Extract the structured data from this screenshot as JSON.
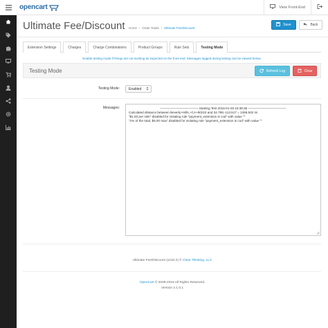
{
  "header": {
    "logo_text": "opencart",
    "view_frontend": "View Front-End"
  },
  "sidebar": {
    "items": [
      "dashboard-icon",
      "tag-icon",
      "puzzle-icon",
      "monitor-icon",
      "cart-icon",
      "user-icon",
      "user-plus-icon",
      "share-icon",
      "gear-icon",
      "chart-icon"
    ]
  },
  "page": {
    "title": "Ultimate Fee/Discount",
    "breadcrumb": [
      "Home",
      "Order Totals",
      "Ultimate Fee/Discount"
    ],
    "save_label": "Save",
    "back_label": "Back"
  },
  "tabs": [
    "Extension Settings",
    "Charges",
    "Charge Combinations",
    "Product Groups",
    "Rule Sets",
    "Testing Mode"
  ],
  "active_tab": "Testing Mode",
  "testing": {
    "help_text": "Enable testing mode if things are not working as expected on the front end. Messages logged during testing can be viewed below.",
    "section_title": "Testing Mode",
    "refresh_label": "Refresh Log",
    "clear_label": "Clear",
    "mode_label": "Testing Mode:",
    "mode_value": "Enabled",
    "messages_label": "Messages:",
    "log_lines": [
      "———————————— Starting Test 2016-01-29 23:39:36 ————————————",
      "Calculated distance between Beverly+Hills,+CA+90210 and 34.789,-113.517 = 1266.502 mi",
      "\"$1.50 per mile\" disabled for violating rule \"payment_extension is cod\" with value \"\"",
      "\"1% of the total, $5.00 max\" disabled for violating rule \"payment_extension is cod\" with value \"\""
    ]
  },
  "credit": {
    "prefix": "Ultimate Fee/Discount (v210.2) © ",
    "link": "Clear Thinking, LLC"
  },
  "footer": {
    "link": "OpenCart",
    "text": " © 2009-2016 All Rights Reserved.",
    "version": "Version 2.1.0.1"
  },
  "colors": {
    "brand": "#1e91cf",
    "sidebar": "#1f1f1f",
    "info": "#5bc0de",
    "danger": "#e56262"
  }
}
